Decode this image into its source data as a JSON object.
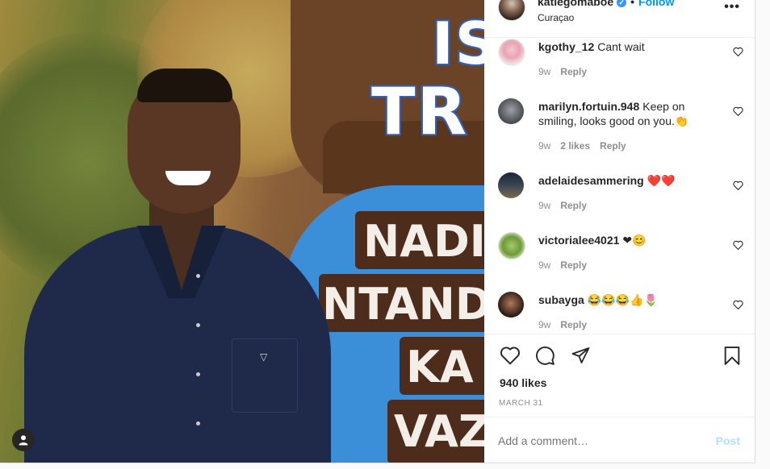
{
  "header": {
    "username": "katlegomaboe",
    "separator": "•",
    "follow_label": "Follow",
    "location": "Curaçao",
    "more_label": "•••"
  },
  "photo": {
    "sign_top_lines": [
      "IS",
      "TR"
    ],
    "sign_planks": [
      "NADI",
      "NTAND",
      "KA",
      "VAZ"
    ],
    "tag_icon": "person-icon"
  },
  "comments": [
    {
      "username": "kgothy_12",
      "text": "Cant wait",
      "age": "9w",
      "likes": "",
      "reply": "Reply"
    },
    {
      "username": "marilyn.fortuin.948",
      "text": "Keep on smiling, looks good on you.👏",
      "age": "9w",
      "likes": "2 likes",
      "reply": "Reply"
    },
    {
      "username": "adelaidesammering",
      "text": "❤️❤️",
      "age": "9w",
      "likes": "",
      "reply": "Reply"
    },
    {
      "username": "victorialee4021",
      "text": "❤😊",
      "age": "9w",
      "likes": "",
      "reply": "Reply"
    },
    {
      "username": "subayga",
      "text": "😂😂😂👍🌷",
      "age": "9w",
      "likes": "",
      "reply": "Reply"
    }
  ],
  "actions": {
    "icons": [
      "heart-icon",
      "comment-icon",
      "share-icon",
      "bookmark-icon"
    ],
    "likes": "940 likes",
    "date": "MARCH 31"
  },
  "comment_box": {
    "placeholder": "Add a comment…",
    "post_label": "Post"
  },
  "colors": {
    "accent": "#0095f6",
    "post_disabled": "#b2dffc",
    "meta": "#8e8e8e",
    "text": "#262626"
  }
}
